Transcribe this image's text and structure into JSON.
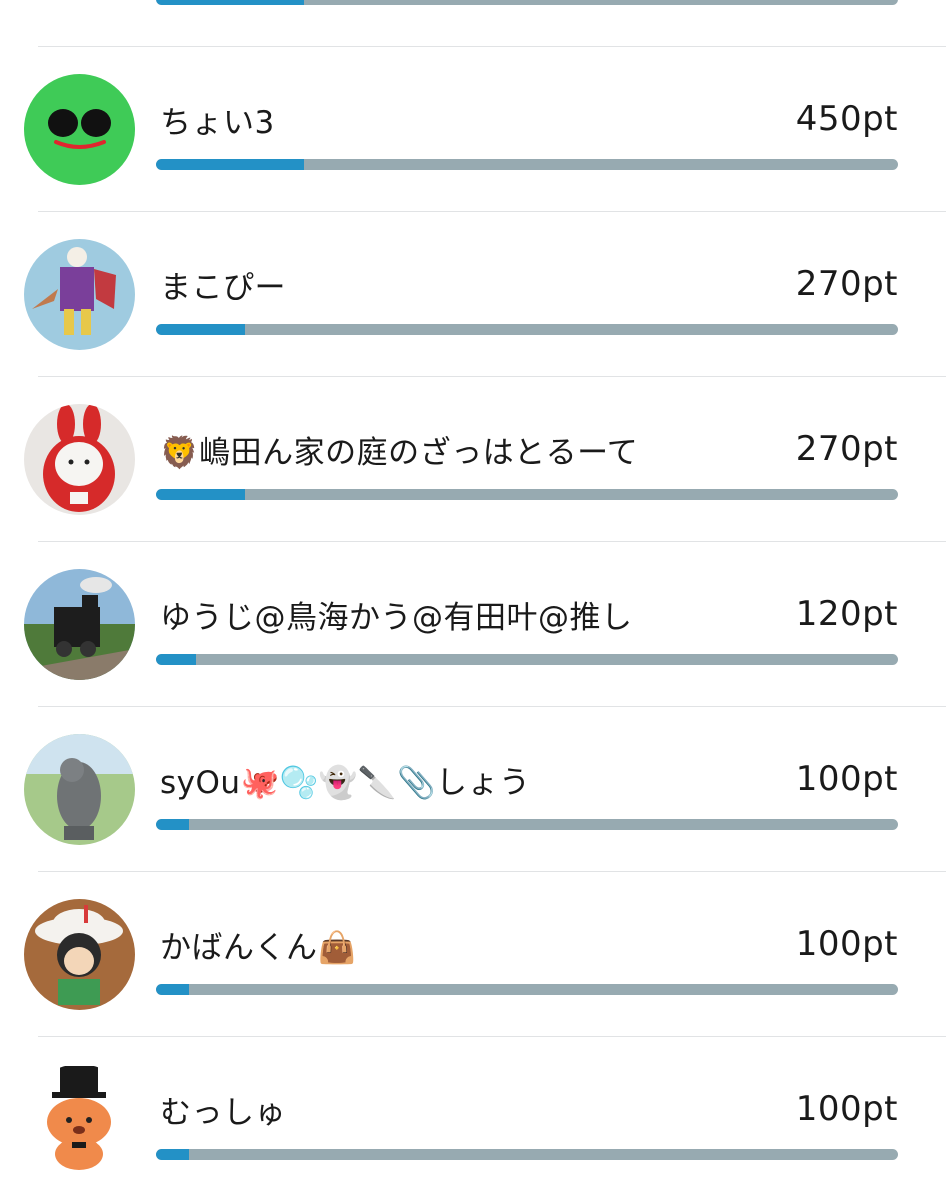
{
  "colors": {
    "bar_fill": "#2391c6",
    "bar_track": "#97aab1",
    "divider": "#e1e3e5"
  },
  "max_points": 2250,
  "top_partial": {
    "progress_fraction": 0.2
  },
  "ranking": [
    {
      "name": "ちょい3",
      "points_label": "450pt",
      "points": 450,
      "avatar_icon": "green-face-avatar-icon"
    },
    {
      "name": "まこぴー",
      "points_label": "270pt",
      "points": 270,
      "avatar_icon": "illustrated-character-avatar-icon"
    },
    {
      "name": "🦁嶋田ん家の庭のざっはとるーて",
      "points_label": "270pt",
      "points": 270,
      "avatar_icon": "red-rabbit-daruma-avatar-icon"
    },
    {
      "name": "ゆうじ@鳥海かう@有田叶@推し",
      "points_label": "120pt",
      "points": 120,
      "avatar_icon": "steam-train-avatar-icon"
    },
    {
      "name": "syOu🐙🫧👻🔪📎しょう",
      "points_label": "100pt",
      "points": 100,
      "avatar_icon": "stone-statue-avatar-icon"
    },
    {
      "name": "かばんくん👜",
      "points_label": "100pt",
      "points": 100,
      "avatar_icon": "anime-figure-avatar-icon"
    },
    {
      "name": "むっしゅ",
      "points_label": "100pt",
      "points": 100,
      "avatar_icon": "top-hat-dog-avatar-icon"
    }
  ]
}
